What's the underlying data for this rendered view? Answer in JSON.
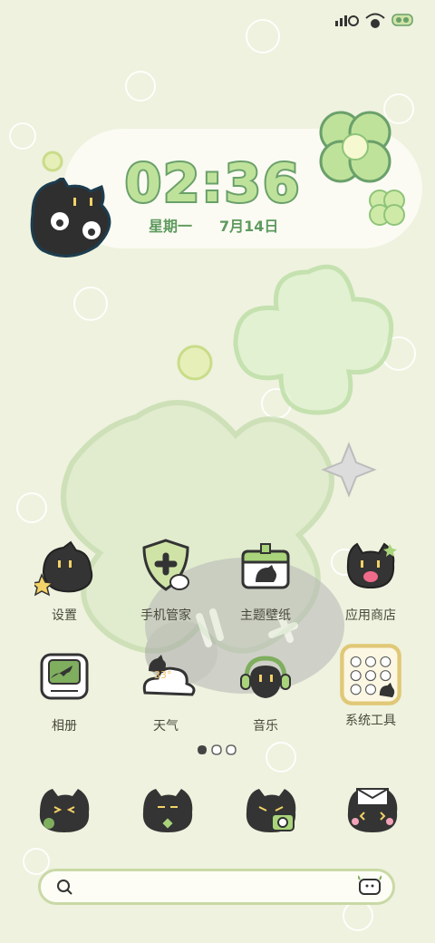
{
  "clock": {
    "time": "02:36",
    "weekday": "星期一",
    "date": "7月14日"
  },
  "apps": [
    {
      "label": "设置",
      "icon": "settings-cat-icon"
    },
    {
      "label": "手机管家",
      "icon": "phone-manager-shield-icon"
    },
    {
      "label": "主题壁纸",
      "icon": "theme-wallpaper-icon"
    },
    {
      "label": "应用商店",
      "icon": "app-store-cat-icon"
    },
    {
      "label": "相册",
      "icon": "gallery-icon"
    },
    {
      "label": "天气",
      "icon": "weather-icon",
      "badge": "33°"
    },
    {
      "label": "音乐",
      "icon": "music-cat-icon"
    },
    {
      "label": "系统工具",
      "icon": "system-tools-folder-icon"
    }
  ],
  "dock": [
    {
      "icon": "phone-cat-icon"
    },
    {
      "icon": "messages-cat-icon"
    },
    {
      "icon": "camera-cat-icon"
    },
    {
      "icon": "browser-cat-icon"
    }
  ],
  "page_indicator": {
    "pages": 3,
    "current": 1
  },
  "colors": {
    "background": "#eef2de",
    "accent": "#6aa06a",
    "clover": "#bfe29b",
    "cat": "#3c3c3c"
  }
}
